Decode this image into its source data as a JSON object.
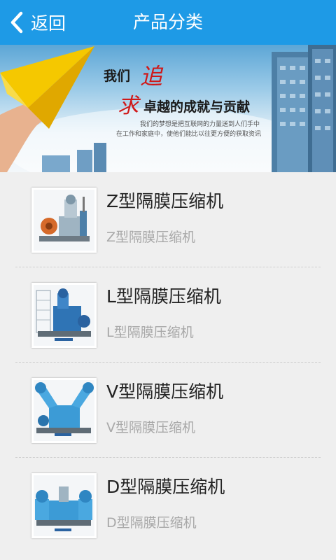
{
  "header": {
    "back_label": "返回",
    "title": "产品分类",
    "background": "#1e9ae6"
  },
  "banner": {
    "slogan_prefix": "我们",
    "slogan_zhui": "追",
    "slogan_qiu": "求",
    "slogan_rest": "卓越的成就与贡献",
    "subtitle_line1": "我们的梦想是把互联网的力量送到人们手中",
    "subtitle_line2": "在工作和家庭中，使他们能比以往更方便的获取资讯"
  },
  "products": [
    {
      "title": "Z型隔膜压缩机",
      "subtitle": "Z型隔膜压缩机",
      "icon": "compressor-z-image"
    },
    {
      "title": "L型隔膜压缩机",
      "subtitle": "L型隔膜压缩机",
      "icon": "compressor-l-image"
    },
    {
      "title": "V型隔膜压缩机",
      "subtitle": "V型隔膜压缩机",
      "icon": "compressor-v-image"
    },
    {
      "title": "D型隔膜压缩机",
      "subtitle": "D型隔膜压缩机",
      "icon": "compressor-d-image"
    }
  ],
  "colors": {
    "accent": "#1e9ae6",
    "slogan_red": "#d01818",
    "list_bg": "#efefef",
    "subtitle_gray": "#a8a8a8"
  }
}
